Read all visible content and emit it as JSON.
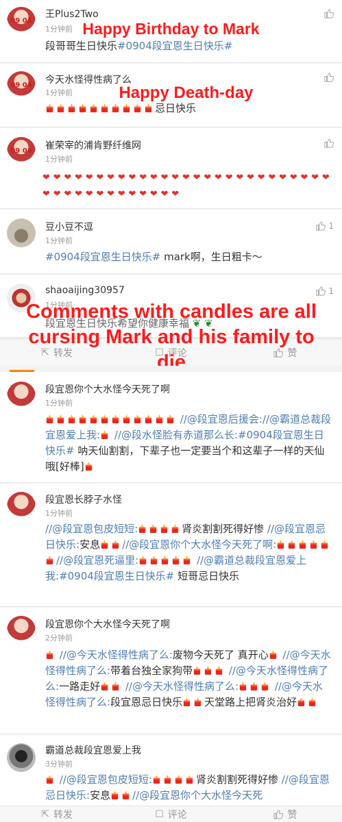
{
  "comments_top": [
    {
      "user": "王Plus2Two",
      "time": "1分钟前",
      "avatar_tag": "09 04",
      "text": "段哥哥生日快乐",
      "tag": "#0904段宜恩生日快乐#"
    },
    {
      "user": "今天水怪得性病了么",
      "time": "1分钟前",
      "avatar_tag": "09 04",
      "candles": 10,
      "text": "忌日快乐"
    },
    {
      "user": "崔荣宰的浦肯野纤维网",
      "time": "1分钟前",
      "avatar_tag": "09 04",
      "hearts": 40
    },
    {
      "user": "豆小豆不逗",
      "time": "1分钟前",
      "like_count": "1",
      "tag": "#0904段宜恩生日快乐#",
      "text": " mark啊，生日粗卡～"
    },
    {
      "user": "shaoaijing30957",
      "time": "1分钟前",
      "like_count": "1",
      "text": "段宜恩生日快乐希望你健康幸福"
    }
  ],
  "captions": {
    "c1": "Happy Birthday to Mark",
    "c2": "Happy Death-day",
    "c3": "Comments with candles are all cursing Mark and his family to die"
  },
  "actions": {
    "forward": "转发",
    "comment": "评论",
    "like": "赞"
  },
  "comments_bottom": [
    {
      "user": "段宜恩你个大水怪今天死了啊",
      "time": "1分钟前"
    },
    {
      "user": "段宜恩长脖子水怪",
      "time": "1分钟前"
    },
    {
      "user": "段宜恩你个大水怪今天死了啊",
      "time": "2分钟前"
    },
    {
      "user": "霸道总裁段宜恩爱上我",
      "time": "3分钟前"
    }
  ],
  "b1": {
    "p1": "//@段宜恩后援会:",
    "p2": "//@霸道总裁段宜恩爱上我:",
    "p3": "//@段水怪脸有赤道那么长:",
    "p4": "#0904段宜恩生日快乐#",
    "p5": " 呐天仙割割，下辈子也一定要当个和这辈子一样的天仙哦[好棒]"
  },
  "b2": {
    "p1": "//@段宜恩包皮短短:",
    "p2": "肾炎割割死得好惨 ",
    "p3": "//@段宜恩忌日快乐:",
    "p4": "安息",
    "p5": "//@段宜恩你个大水怪今天死了啊:",
    "p6": "//@段宜恩死逼里:",
    "p7": "//@霸道总裁段宜恩爱上我:",
    "p8": "#0904段宜恩生日快乐#",
    "p9": " 短哥忌日快乐"
  },
  "b3": {
    "p1": "//@今天水怪得性病了么:",
    "p2": "废物今天死了 真开心",
    "p3": "//@今天水怪得性病了么:",
    "p4": "带着台独全家狗带",
    "p5": "//@今天水怪得性病了么:",
    "p6": "一路走好",
    "p7": "//@今天水怪得性病了么:",
    "p8": "//@今天水怪得性病了么:",
    "p9": "段宜恩忌日快乐",
    "p10": "天堂路上把肾炎治好"
  },
  "b4": {
    "p1": "//@段宜恩包皮短短:",
    "p2": "肾炎割割死得好惨 ",
    "p3": "//@段宜恩忌日快乐:",
    "p4": "安息",
    "p5": "//@段宜恩你个大水怪今天死"
  },
  "colors": {
    "caption": "#ff1a1a",
    "link": "#507daf",
    "tab_accent": "#ff8200"
  }
}
